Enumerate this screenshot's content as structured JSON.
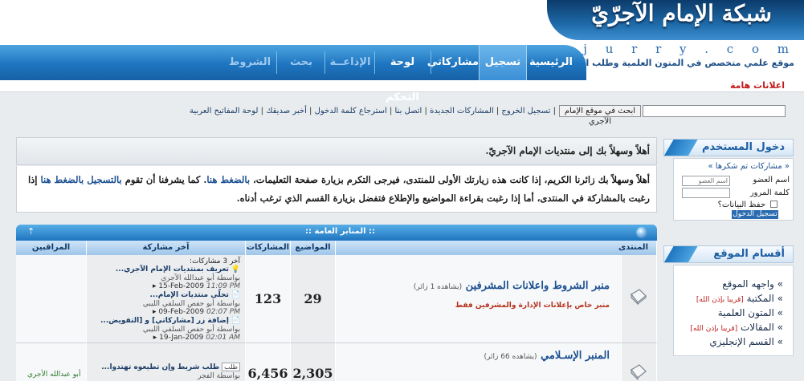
{
  "site": {
    "logo_text": "شبكة الإمام الآجرّيّ",
    "url": "w w w . a j u r r y . c o m",
    "tagline": "موقع علمي متخصص في المتون العلمية وطلب العلم الشرعي"
  },
  "nav": {
    "home": "الرئيسية",
    "register": "تسجيل",
    "my_posts": "مشاركاتي",
    "control_panel": "لوحة التحكم",
    "radio": "الإذاعــة",
    "search": "بحث",
    "rules": "الشروط"
  },
  "announcements_label": "اعلانات هامة",
  "search": {
    "button": "ابحث في موقع الإمام الآجري",
    "value": ""
  },
  "quick_links": [
    "تسجيل الخروج",
    "المشاركات الجديدة",
    "اتصل بنا",
    "استرجاع كلمة الدخول",
    "أخبر صديقك",
    "لوحة المفاتيح العربية"
  ],
  "login": {
    "title": "دخول المستخدم",
    "registered_link": "« مشاركات تم شكرها »",
    "username_label": "اسم العضو",
    "username_placeholder": "اسم العضو",
    "password_label": "كلمة المرور",
    "remember_label": "حفظ البيانات؟",
    "submit": "تسجيل الدخول"
  },
  "sections": {
    "title": "أقسام الموقع",
    "items": [
      {
        "label": "» واجهه الموقع",
        "soon": ""
      },
      {
        "label": "» المكتبة",
        "soon": "[قريبا بإذن الله]"
      },
      {
        "label": "» المتون العلمية",
        "soon": ""
      },
      {
        "label": "» المقالات",
        "soon": "[قريبا بإذن الله]"
      },
      {
        "label": "» القسم الإنجليزي",
        "soon": ""
      }
    ]
  },
  "welcome": {
    "title": "أهلاً وسهلاً بك إلى منتديات الإمام الآجريّ.",
    "text_1": "أهلاً وسهلاً بك زائرنا الكريم، إذا كانت هذه زيارتك الأولى للمنتدى، فيرجى التكرم بزيارة صفحة التعليمات، ",
    "link_1": "بالضغط هنا",
    "text_2": ". كما يشرفنا أن تقوم ",
    "link_2": "بالتسجيل بالضغط هنا",
    "text_3": " إذا رغبت بالمشاركة في المنتدى، أما إذا رغبت بقراءة المواضيع والإطلاع فتفضل بزيارة القسم الذي ترغب أدناه."
  },
  "forum_table": {
    "category_title": ":: المنابر العامة ::",
    "collapse_icon": "⇡",
    "headers": {
      "forum": "المنتدى",
      "topics": "المواضيع",
      "posts": "المشاركات",
      "last_post": "آخر مشاركة",
      "moderators": "المراقبين"
    },
    "rows": [
      {
        "title": "منبر الشروط واعلانات المشرفين",
        "viewers": "(يشاهده 1 زائر)",
        "description": "منبر خاص بإعلانات الإدارة والمشرفين فقط",
        "topics": "29",
        "posts": "123",
        "last_posts_header": "آخر 3 مشاركات:",
        "last_posts": [
          {
            "title": "تعريف بمنتديات الإمام الآجري...",
            "by": "بواسطة أبو عبدالله الآجري",
            "date": "15-Feb-2009",
            "time": "11:09 PM"
          },
          {
            "title": "تحلّى منتديات الإمام...",
            "by": "بواسطة أبو حفص السلفي الليبي",
            "date": "09-Feb-2009",
            "time": "02:07 PM"
          },
          {
            "title": "إضافة زر [مشاركاتي] و [التفويض...",
            "by": "بواسطة أبو حفص السلفي الليبي",
            "date": "19-Jan-2009",
            "time": "02:01 AM"
          }
        ],
        "moderators": ""
      },
      {
        "title": "المنبر الإسـلامي",
        "viewers": "(يشاهده 66 زائر)",
        "description": "",
        "topics": "2,305",
        "posts": "6,456",
        "last_post_tag": "طلب",
        "last_post_title": "طلب شريط وإن تطيعوه تهتدوا...",
        "last_post_by": "بواسطة الفجر",
        "moderators": "أبو عبدالله الأجري"
      }
    ]
  }
}
